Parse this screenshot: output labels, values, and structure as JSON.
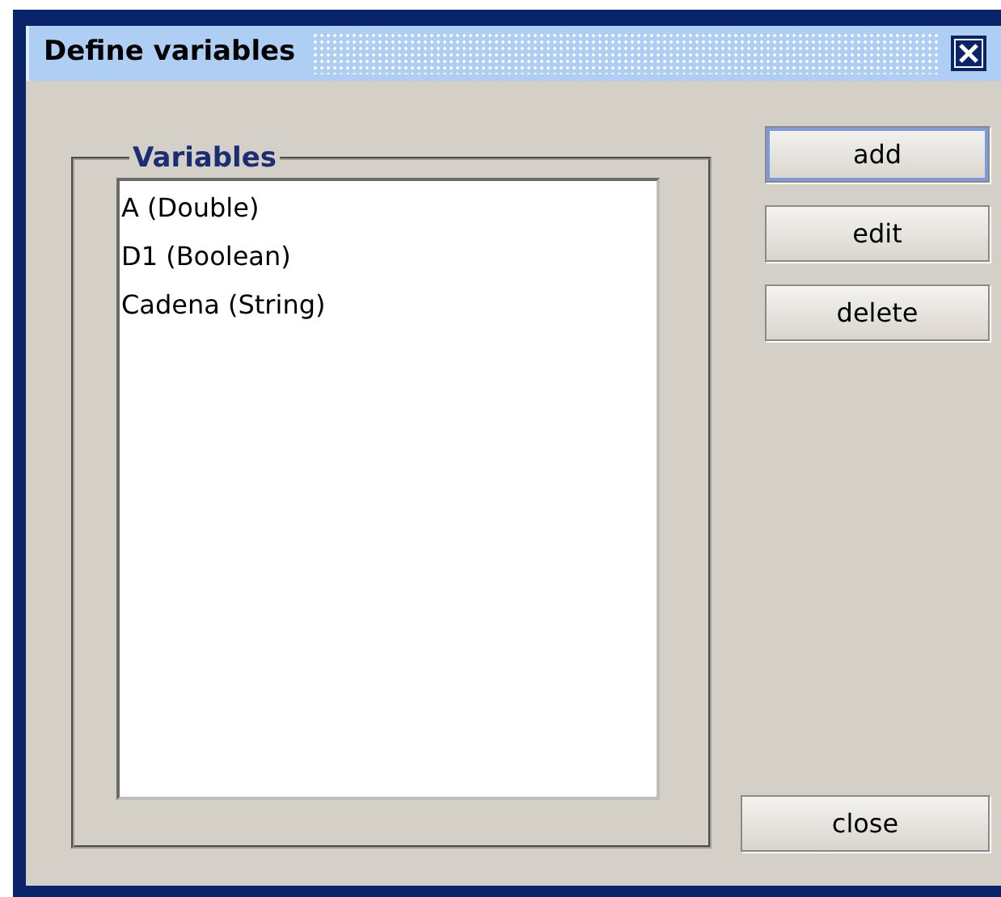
{
  "window": {
    "title": "Define variables"
  },
  "group": {
    "title": "Variables",
    "items": [
      {
        "label": "A (Double)"
      },
      {
        "label": "D1 (Boolean)"
      },
      {
        "label": "Cadena (String)"
      }
    ]
  },
  "buttons": [
    {
      "label": "add",
      "focused": true
    },
    {
      "label": "edit",
      "focused": false
    },
    {
      "label": "delete",
      "focused": false
    }
  ],
  "close_button": {
    "label": "close",
    "focused": false
  }
}
